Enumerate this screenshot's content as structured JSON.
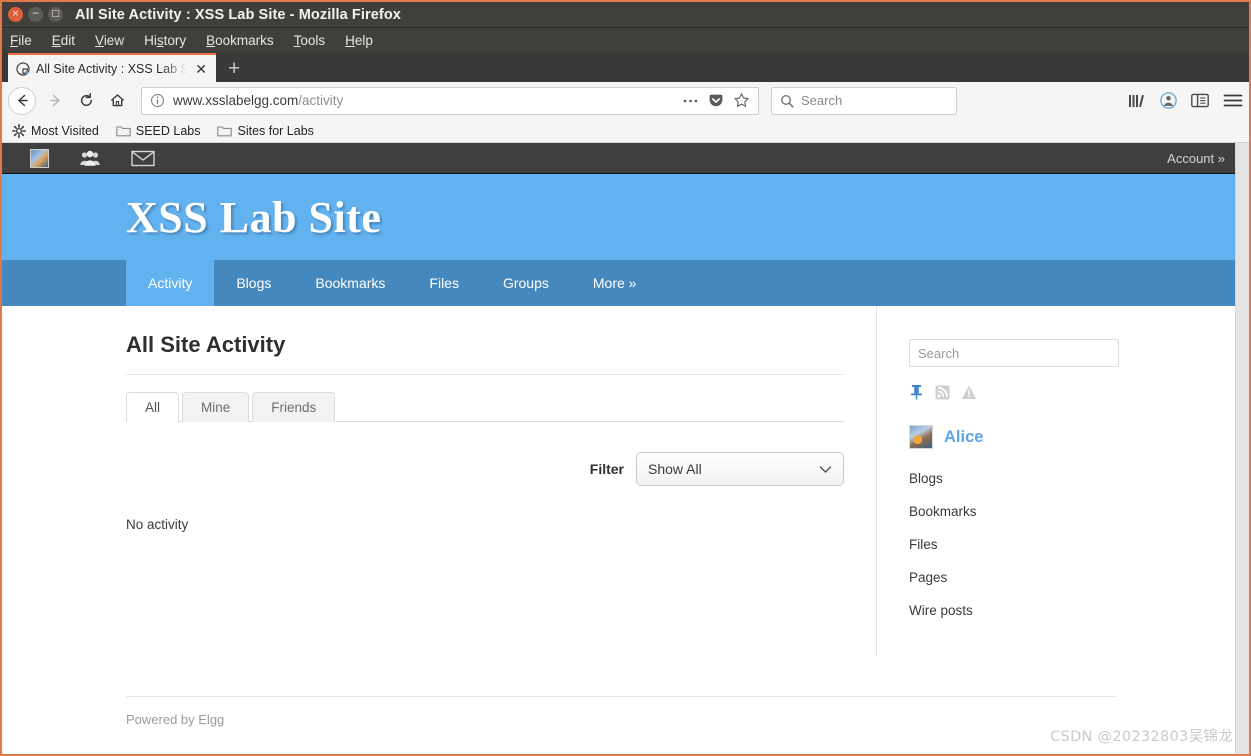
{
  "window": {
    "title": "All Site Activity : XSS Lab Site - Mozilla Firefox",
    "buttons": {
      "close": "×",
      "minimize": "−",
      "maximize": "□"
    }
  },
  "menubar": [
    {
      "label": "File",
      "accel": "F"
    },
    {
      "label": "Edit",
      "accel": "E"
    },
    {
      "label": "View",
      "accel": "V"
    },
    {
      "label": "History",
      "accel": "s"
    },
    {
      "label": "Bookmarks",
      "accel": "B"
    },
    {
      "label": "Tools",
      "accel": "T"
    },
    {
      "label": "Help",
      "accel": "H"
    }
  ],
  "tabstrip": {
    "tab_title": "All Site Activity : XSS Lab Site",
    "close_glyph": "✕",
    "newtab_glyph": "+"
  },
  "toolbar": {
    "url_host": "www.xsslabelgg.com",
    "url_path": "/activity",
    "search_placeholder": "Search",
    "back_glyph": "←",
    "forward_glyph": "→",
    "reload_glyph": "↻",
    "home_glyph": "⌂",
    "page_actions_glyph": "…"
  },
  "bookmarks": [
    {
      "label": "Most Visited",
      "icon": "star-burst-icon"
    },
    {
      "label": "SEED Labs",
      "icon": "folder-icon"
    },
    {
      "label": "Sites for Labs",
      "icon": "folder-icon"
    }
  ],
  "elgg_topbar": {
    "account_label": "Account  »"
  },
  "site": {
    "title": "XSS Lab Site",
    "nav": [
      {
        "label": "Activity",
        "active": true
      },
      {
        "label": "Blogs",
        "active": false
      },
      {
        "label": "Bookmarks",
        "active": false
      },
      {
        "label": "Files",
        "active": false
      },
      {
        "label": "Groups",
        "active": false
      },
      {
        "label": "More  »",
        "active": false
      }
    ]
  },
  "main": {
    "page_title": "All Site Activity",
    "tabs": [
      {
        "label": "All",
        "active": true
      },
      {
        "label": "Mine",
        "active": false
      },
      {
        "label": "Friends",
        "active": false
      }
    ],
    "filter_label": "Filter",
    "filter_value": "Show All",
    "filter_options": [
      "Show All"
    ],
    "empty_message": "No activity"
  },
  "sidebar": {
    "search_placeholder": "Search",
    "icons": [
      {
        "name": "pushpin-icon",
        "color": "#3f87c9"
      },
      {
        "name": "rss-icon",
        "color": "#c7c7c7"
      },
      {
        "name": "warning-icon",
        "color": "#c7c7c7"
      }
    ],
    "owner_name": "Alice",
    "links": [
      {
        "label": "Blogs"
      },
      {
        "label": "Bookmarks"
      },
      {
        "label": "Files"
      },
      {
        "label": "Pages"
      },
      {
        "label": "Wire posts"
      }
    ]
  },
  "footer": {
    "powered_by": "Powered by Elgg"
  },
  "watermark": "CSDN @20232803吴锦龙",
  "colors": {
    "header_blue": "#62b2f0",
    "nav_blue": "#4488bd",
    "accent_orange": "#e8703e",
    "link_blue": "#5ba4e5"
  }
}
